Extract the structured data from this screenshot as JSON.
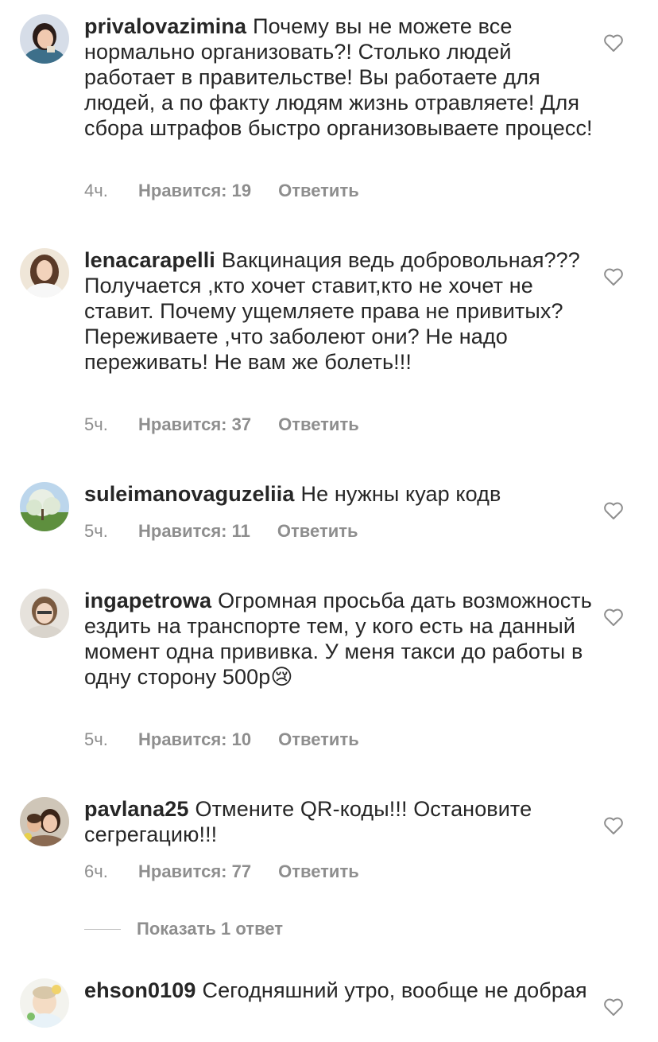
{
  "comments": [
    {
      "username": "privalovazimina",
      "text": "Почему вы не можете все нормально организовать?! Столько людей работает в правительстве! Вы работаете для людей, а по факту людям жизнь отравляете! Для сбора штрафов быстро организовываете процесс!",
      "time": "4ч.",
      "likes": "Нравится: 19",
      "reply": "Ответить"
    },
    {
      "username": "lenacarapelli",
      "text": "Вакцинация ведь добровольная??? Получается ,кто хочет ставит,кто не хочет не ставит. Почему ущемляете права не привитых? Переживаете ,что заболеют они? Не надо переживать! Не вам же болеть!!!",
      "time": "5ч.",
      "likes": "Нравится: 37",
      "reply": "Ответить"
    },
    {
      "username": "suleimanovaguzeliia",
      "text": "Не нужны куар кодв",
      "time": "5ч.",
      "likes": "Нравится: 11",
      "reply": "Ответить"
    },
    {
      "username": "ingapetrowa",
      "text": "Огромная просьба дать возможность ездить на транспорте тем, у кого есть на данный момент одна прививка. У меня такси до работы в одну сторону 500р😢",
      "time": "5ч.",
      "likes": "Нравится: 10",
      "reply": "Ответить"
    },
    {
      "username": "pavlana25",
      "text": "Отмените QR-коды!!! Остановите сегрегацию!!!",
      "time": "6ч.",
      "likes": "Нравится: 77",
      "reply": "Ответить"
    },
    {
      "username": "ehson0109",
      "text": "Сегодняшний утро, вообще не добрая"
    }
  ],
  "show_replies": "Показать 1 ответ",
  "colors": {
    "text": "#262626",
    "secondary": "#8e8e8e",
    "background": "#ffffff"
  }
}
